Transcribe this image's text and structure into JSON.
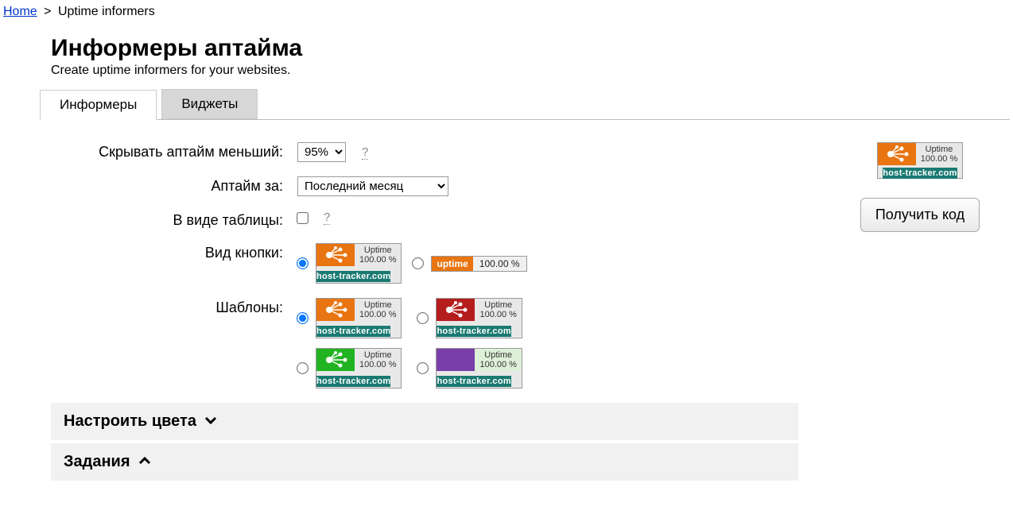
{
  "breadcrumb": {
    "home": "Home",
    "sep": ">",
    "current": "Uptime informers"
  },
  "page": {
    "title": "Информеры аптайма",
    "subtitle": "Create uptime informers for your websites."
  },
  "tabs": [
    {
      "label": "Информеры",
      "active": true
    },
    {
      "label": "Виджеты",
      "active": false
    }
  ],
  "form": {
    "hide_uptime_less": {
      "label": "Скрывать аптайм меньший:",
      "value": "95%",
      "help": "?"
    },
    "uptime_for": {
      "label": "Аптайм за:",
      "value": "Последний месяц"
    },
    "as_table": {
      "label": "В виде таблицы:",
      "checked": false,
      "help": "?"
    },
    "button_style": {
      "label": "Вид кнопки:"
    },
    "templates": {
      "label": "Шаблоны:"
    }
  },
  "badge": {
    "uptime_label": "Uptime",
    "uptime_value": "100.00 %",
    "domain": "host-tracker.com",
    "small_label": "uptime",
    "small_value": "100.00 %"
  },
  "accordion": {
    "colors": "Настроить цвета",
    "tasks": "Задания"
  },
  "side": {
    "get_code": "Получить код"
  }
}
